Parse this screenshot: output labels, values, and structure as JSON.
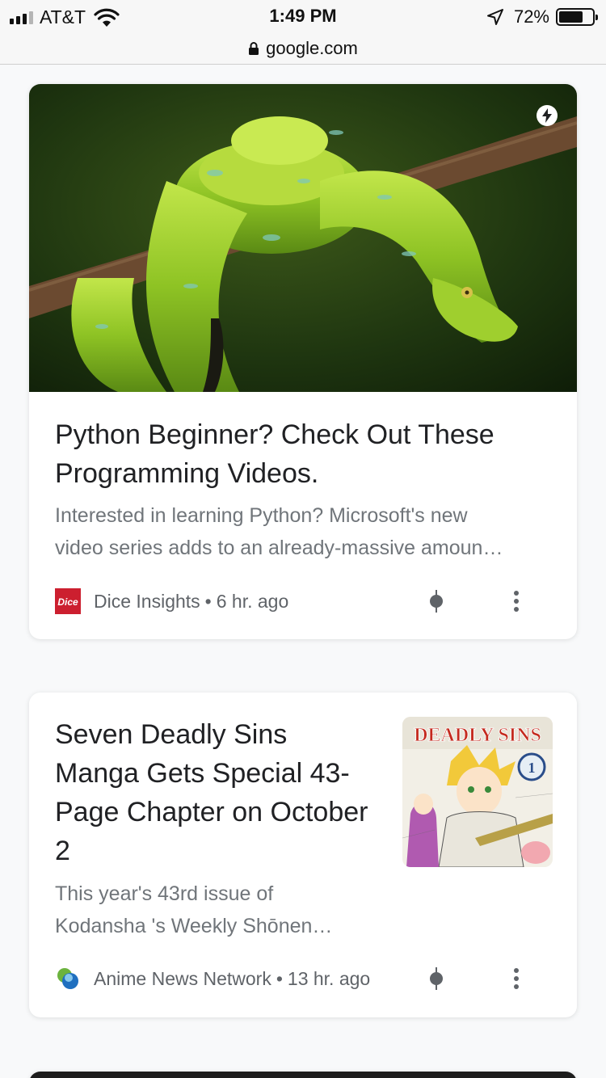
{
  "status_bar": {
    "carrier": "AT&T",
    "time": "1:49 PM",
    "battery_percent": "72%",
    "battery_level": 0.72,
    "signal_bars": 3,
    "icons": [
      "signal-icon",
      "wifi-icon",
      "location-arrow-icon",
      "battery-icon"
    ]
  },
  "url_bar": {
    "url": "google.com",
    "icon": "lock-icon"
  },
  "cards": [
    {
      "title": "Python Beginner? Check Out These Programming Videos.",
      "snippet_line1": "Interested in learning Python? Microsoft's new",
      "snippet_line2": "video series adds to an already-massive amoun…",
      "source": "Dice Insights",
      "separator": "•",
      "age": "6 hr. ago",
      "favicon_text": "Dice",
      "favicon_color": "#cc1f2f",
      "icons": [
        "amp-lightning-icon",
        "dice-logo-icon",
        "bullet-icon",
        "more-vert-icon"
      ]
    },
    {
      "title": "Seven Deadly Sins Manga Gets Special 43-Page Chapter on October 2",
      "snippet_line1": "This year's 43rd issue of",
      "snippet_line2": "Kodansha 's Weekly Shōnen…",
      "thumbnail_title": "DEADLY SINS",
      "thumbnail_volume": "1",
      "source": "Anime News Network",
      "separator": "•",
      "age": "13 hr. ago",
      "icons": [
        "anime-news-network-logo-icon",
        "bullet-icon",
        "more-vert-icon"
      ]
    }
  ],
  "colors": {
    "background": "#f8f9fa",
    "title": "#202124",
    "snippet": "#70757a",
    "meta": "#5f6368"
  }
}
